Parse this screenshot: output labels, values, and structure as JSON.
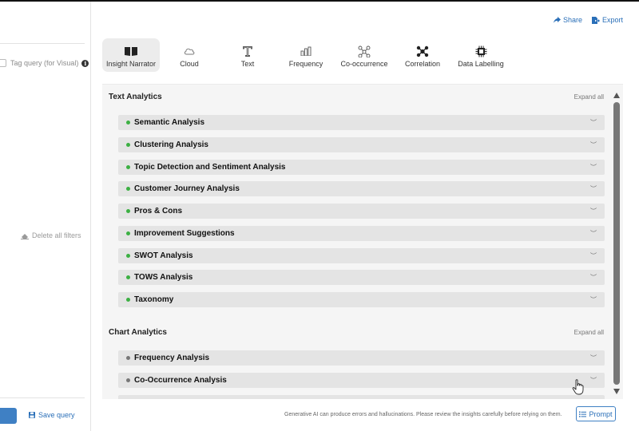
{
  "left_panel": {
    "tag_query_label": "Tag query (for Visual)",
    "delete_filters_label": "Delete all filters",
    "save_query_label": "Save query"
  },
  "header": {
    "share_label": "Share",
    "export_label": "Export"
  },
  "tabs": [
    {
      "label": "Insight Narrator",
      "icon": "book-icon",
      "active": true
    },
    {
      "label": "Cloud",
      "icon": "cloud-icon"
    },
    {
      "label": "Text",
      "icon": "text-icon"
    },
    {
      "label": "Frequency",
      "icon": "bar-chart-icon"
    },
    {
      "label": "Co-occurrence",
      "icon": "network-icon"
    },
    {
      "label": "Correlation",
      "icon": "correlation-icon"
    },
    {
      "label": "Data Labelling",
      "icon": "chip-icon"
    }
  ],
  "text_analytics": {
    "title": "Text Analytics",
    "expand_label": "Expand all",
    "dot_color": "#3cb043",
    "items": [
      "Semantic Analysis",
      "Clustering Analysis",
      "Topic Detection and Sentiment Analysis",
      "Customer Journey Analysis",
      "Pros & Cons",
      "Improvement Suggestions",
      "SWOT Analysis",
      "TOWS Analysis",
      "Taxonomy"
    ]
  },
  "chart_analytics": {
    "title": "Chart Analytics",
    "expand_label": "Expand all",
    "dot_color": "#777777",
    "items": [
      "Frequency Analysis",
      "Co-Occurrence Analysis"
    ]
  },
  "footer": {
    "disclaimer": "Generative AI can produce errors and hallucinations. Please review the insights carefully before relying on them.",
    "prompt_label": "Prompt"
  },
  "colors": {
    "accent": "#2a6fb8",
    "row_bg": "#e4e4e4",
    "panel_bg": "#f5f5f5"
  }
}
